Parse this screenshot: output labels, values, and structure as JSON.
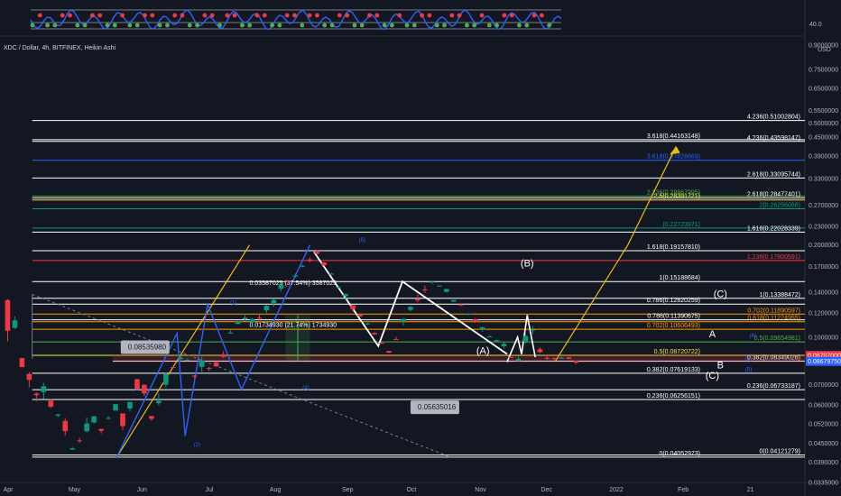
{
  "title": "XDC / Dollar, 4h, BITFINEX, Heikin Ashi",
  "indicator": {
    "level_label": "40.0"
  },
  "chart_data": {
    "type": "candlestick",
    "y_scale": "log",
    "ylim": [
      0.0335,
      0.95
    ],
    "y_ticks": [
      {
        "v": 0.9,
        "t": "0.9000000"
      },
      {
        "v": 0.75,
        "t": "0.7500000"
      },
      {
        "v": 0.65,
        "t": "0.6500000"
      },
      {
        "v": 0.55,
        "t": "0.5500000"
      },
      {
        "v": 0.5,
        "t": "0.5000000"
      },
      {
        "v": 0.45,
        "t": "0.4500000"
      },
      {
        "v": 0.39,
        "t": "0.3900000"
      },
      {
        "v": 0.33,
        "t": "0.3300000"
      },
      {
        "v": 0.27,
        "t": "0.2700000"
      },
      {
        "v": 0.23,
        "t": "0.2300000"
      },
      {
        "v": 0.2,
        "t": "0.2000000"
      },
      {
        "v": 0.17,
        "t": "0.1700000"
      },
      {
        "v": 0.14,
        "t": "0.1400000"
      },
      {
        "v": 0.12,
        "t": "0.1200000"
      },
      {
        "v": 0.1,
        "t": "0.1000000"
      },
      {
        "v": 0.07,
        "t": "0.0700000"
      },
      {
        "v": 0.06,
        "t": "0.0600000"
      },
      {
        "v": 0.052,
        "t": "0.0520000"
      },
      {
        "v": 0.045,
        "t": "0.0450000"
      },
      {
        "v": 0.039,
        "t": "0.0390000"
      },
      {
        "v": 0.0335,
        "t": "0.0335000"
      }
    ],
    "y_unit": "USD",
    "x_months": [
      "Apr",
      "May",
      "Jun",
      "Jul",
      "Aug",
      "Sep",
      "Oct",
      "Nov",
      "Dec",
      "2022",
      "Feb",
      "21"
    ],
    "price_tags": [
      {
        "v": 0.08707,
        "t": "0.08707000",
        "color": "#f23645"
      },
      {
        "v": 0.0868,
        "t": "0.08679750",
        "color": "#2962ff"
      }
    ],
    "levels": [
      {
        "v": 0.51003,
        "t": "4.236(0.51002804)",
        "color": "#ffffff",
        "start": 0.04
      },
      {
        "v": 0.44163,
        "t": "3.618(0.44163148)",
        "color": "#ffffff",
        "start": 0.04
      },
      {
        "v": 0.43598,
        "t": "4.236(0.43598147)",
        "color": "#ffffff",
        "start": 0.04
      },
      {
        "v": 0.3783,
        "t": "3.618(0.37828869)",
        "color": "#2962ff",
        "start": 0.04
      },
      {
        "v": 0.33096,
        "t": "2.618(0.33095744)",
        "color": "#ffffff",
        "start": 0.04
      },
      {
        "v": 0.2888,
        "t": "2.236(0.28867995)",
        "color": "#4caf50",
        "start": 0.04
      },
      {
        "v": 0.2848,
        "t": "2.618(0.28477401)",
        "color": "#ffffff",
        "start": 0.04
      },
      {
        "v": 0.2807,
        "t": "2.5(0.28391721)",
        "color": "#ffeb3b",
        "start": 0.04
      },
      {
        "v": 0.26256,
        "t": "2(0.26256088)",
        "color": "#089981",
        "start": 0.04
      },
      {
        "v": 0.22724,
        "t": "(0.22723971)",
        "color": "#089981",
        "start": 0.04
      },
      {
        "v": 0.22028,
        "t": "1.618(0.22028339)",
        "color": "#ffffff",
        "start": 0.04
      },
      {
        "v": 0.19158,
        "t": "1.618(0.19157810)",
        "color": "#ffffff",
        "start": 0.04
      },
      {
        "v": 0.178,
        "t": "1.236(0.17800591)",
        "color": "#f23645",
        "start": 0.04
      },
      {
        "v": 0.15189,
        "t": "1(0.15188684)",
        "color": "#ffffff",
        "start": 0.04
      },
      {
        "v": 0.13388,
        "t": "1(0.13388472)",
        "color": "#ffffff",
        "start": 0.04
      },
      {
        "v": 0.1282,
        "t": "0.786(0.12820259)",
        "color": "#ffffff",
        "start": 0.04
      },
      {
        "v": 0.1189,
        "t": "0.702(0.11890597)",
        "color": "#ff9800",
        "start": 0.04
      },
      {
        "v": 0.1139,
        "t": "0.786(0.11390675)",
        "color": "#ffffff",
        "start": 0.04
      },
      {
        "v": 0.1123,
        "t": "0.618(0.11224955)",
        "color": "#ff9800",
        "start": 0.04
      },
      {
        "v": 0.1061,
        "t": "0.702(0.10606493)",
        "color": "#ff9800",
        "start": 0.04
      },
      {
        "v": 0.0965,
        "t": "0.5(0.09654981)",
        "color": "#4caf50",
        "start": 0.04
      },
      {
        "v": 0.08721,
        "t": "0.5(0.08720722)",
        "color": "#ffeb3b",
        "start": 0.04
      },
      {
        "v": 0.08349,
        "t": "0.382(0.08349028)",
        "color": "#ffffff",
        "start": 0.14
      },
      {
        "v": 0.07619,
        "t": "0.382(0.07619133)",
        "color": "#ffffff",
        "start": 0.04
      },
      {
        "v": 0.06733,
        "t": "0.236(0.06733187)",
        "color": "#ffffff",
        "start": 0.04
      },
      {
        "v": 0.06256,
        "t": "0.236(0.06256151)",
        "color": "#ffffff",
        "start": 0.04
      },
      {
        "v": 0.04121,
        "t": "0(0.04121279)",
        "color": "#ffffff",
        "start": 0.04
      },
      {
        "v": 0.04053,
        "t": "0(0.04052973)",
        "color": "#ffffff",
        "start": 0.04
      }
    ],
    "annotations": {
      "box1": "0.08535980",
      "box2": "0.05635016",
      "measure1": "0.03587025 (37.54%) 3587025",
      "measure2": "0.01734930 (21.74%) 1734930"
    },
    "waves": [
      {
        "t": "(A)",
        "d": 0.6,
        "v": 0.088
      },
      {
        "t": "(B)",
        "d": 0.655,
        "v": 0.17
      },
      {
        "t": "(C)",
        "d": 0.895,
        "v": 0.135
      },
      {
        "t": "(C)",
        "d": 0.885,
        "v": 0.073
      },
      {
        "t": "A",
        "d": 0.885,
        "v": 0.1
      },
      {
        "t": "B",
        "d": 0.895,
        "v": 0.079
      },
      {
        "t": "(5)",
        "d": 0.45,
        "v": 0.205
      },
      {
        "t": "(4)",
        "d": 0.38,
        "v": 0.0675
      },
      {
        "t": "(2)",
        "d": 0.245,
        "v": 0.044
      },
      {
        "t": "(1)",
        "d": 0.29,
        "v": 0.128
      },
      {
        "t": "(5)",
        "d": 0.93,
        "v": 0.0775
      },
      {
        "t": "(3)",
        "d": 0.93,
        "v": 0.084
      },
      {
        "t": "(4)",
        "d": 0.935,
        "v": 0.1
      }
    ],
    "ohlc": [
      [
        0.1321,
        0.1331,
        0.0967,
        0.1049
      ],
      [
        0.1072,
        0.1169,
        0.1063,
        0.1134
      ],
      [
        0.0854,
        0.0854,
        0.0798,
        0.0798
      ],
      [
        0.0758,
        0.0768,
        0.0686,
        0.0725
      ],
      [
        0.0654,
        0.0659,
        0.0617,
        0.0646
      ],
      [
        0.0661,
        0.0709,
        0.0628,
        0.0691
      ],
      [
        0.062,
        0.0628,
        0.0586,
        0.0592
      ],
      [
        0.0554,
        0.0561,
        0.0547,
        0.0559
      ],
      [
        0.0532,
        0.0544,
        0.0476,
        0.0493
      ],
      [
        0.0429,
        0.0438,
        0.0428,
        0.0433
      ],
      [
        0.046,
        0.0469,
        0.0451,
        0.0459
      ],
      [
        0.0493,
        0.0546,
        0.0488,
        0.0522
      ],
      [
        0.0526,
        0.0553,
        0.0522,
        0.0551
      ],
      [
        0.0501,
        0.0503,
        0.0484,
        0.0494
      ],
      [
        0.0543,
        0.0552,
        0.0541,
        0.0544
      ],
      [
        0.0576,
        0.0606,
        0.0574,
        0.0604
      ],
      [
        0.0563,
        0.0564,
        0.0497,
        0.0512
      ],
      [
        0.0584,
        0.0615,
        0.0572,
        0.0614
      ],
      [
        0.0728,
        0.0732,
        0.0671,
        0.0678
      ],
      [
        0.0698,
        0.0703,
        0.0641,
        0.0654
      ],
      [
        0.0552,
        0.0553,
        0.0532,
        0.0541
      ],
      [
        0.0608,
        0.0655,
        0.0599,
        0.0619
      ],
      [
        0.0699,
        0.0765,
        0.0686,
        0.0757
      ],
      [
        0.0798,
        0.0805,
        0.0791,
        0.0793
      ],
      [
        0.0847,
        0.0872,
        0.0834,
        0.0859
      ],
      [
        0.0837,
        0.0853,
        0.0836,
        0.0843
      ],
      [
        0.0748,
        0.0752,
        0.0727,
        0.0743
      ],
      [
        0.0799,
        0.0862,
        0.0769,
        0.0837
      ],
      [
        0.0792,
        0.08,
        0.0774,
        0.0791
      ],
      [
        0.0827,
        0.0829,
        0.0801,
        0.0802
      ],
      [
        0.0879,
        0.09,
        0.0856,
        0.0862
      ],
      [
        0.1029,
        0.106,
        0.1026,
        0.1035
      ],
      [
        0.1105,
        0.1133,
        0.1104,
        0.1126
      ],
      [
        0.1144,
        0.118,
        0.1129,
        0.1157
      ],
      [
        0.1116,
        0.1154,
        0.1112,
        0.1147
      ],
      [
        0.1158,
        0.1182,
        0.1139,
        0.1155
      ],
      [
        0.1223,
        0.1274,
        0.1199,
        0.1266
      ],
      [
        0.1292,
        0.1334,
        0.1255,
        0.1322
      ],
      [
        0.1439,
        0.1516,
        0.1407,
        0.1483
      ],
      [
        0.1523,
        0.1528,
        0.1499,
        0.1519
      ],
      [
        0.1578,
        0.1613,
        0.1565,
        0.159
      ],
      [
        0.1705,
        0.1726,
        0.1692,
        0.171
      ],
      [
        0.1794,
        0.1823,
        0.1757,
        0.1771
      ],
      [
        0.19,
        0.1919,
        0.1863,
        0.1872
      ],
      [
        0.1752,
        0.1763,
        0.1704,
        0.1718
      ],
      [
        0.161,
        0.1621,
        0.1606,
        0.1612
      ],
      [
        0.1456,
        0.1464,
        0.1446,
        0.1457
      ],
      [
        0.1361,
        0.1388,
        0.1323,
        0.1383
      ],
      [
        0.127,
        0.127,
        0.1213,
        0.1233
      ],
      [
        0.1182,
        0.1186,
        0.1167,
        0.1169
      ],
      [
        0.1108,
        0.1116,
        0.1093,
        0.1108
      ],
      [
        0.1032,
        0.1037,
        0.1017,
        0.1021
      ],
      [
        0.0958,
        0.0967,
        0.0951,
        0.0955
      ],
      [
        0.0901,
        0.0901,
        0.0887,
        0.0889
      ],
      [
        0.0986,
        0.1003,
        0.0983,
        0.0985
      ],
      [
        0.1121,
        0.1154,
        0.1092,
        0.1146
      ],
      [
        0.1227,
        0.1264,
        0.1215,
        0.1255
      ],
      [
        0.1331,
        0.1379,
        0.1299,
        0.1318
      ],
      [
        0.1431,
        0.1473,
        0.1396,
        0.1426
      ],
      [
        0.1517,
        0.152,
        0.1494,
        0.1518
      ],
      [
        0.1473,
        0.1475,
        0.1466,
        0.1473
      ],
      [
        0.1406,
        0.1441,
        0.1398,
        0.1436
      ],
      [
        0.1306,
        0.1326,
        0.1304,
        0.1322
      ],
      [
        0.1279,
        0.1284,
        0.1262,
        0.1273
      ],
      [
        0.119,
        0.1196,
        0.1177,
        0.1194
      ],
      [
        0.1144,
        0.1153,
        0.1114,
        0.1118
      ],
      [
        0.1059,
        0.1081,
        0.1042,
        0.1077
      ],
      [
        0.1005,
        0.1015,
        0.0997,
        0.1005
      ],
      [
        0.0969,
        0.098,
        0.0967,
        0.0978
      ],
      [
        0.0933,
        0.0963,
        0.0917,
        0.0951
      ],
      [
        0.0861,
        0.0861,
        0.0856,
        0.0859
      ],
      [
        0.0836,
        0.0865,
        0.0835,
        0.0849
      ],
      [
        0.0966,
        0.1032,
        0.0956,
        0.1009
      ],
      [
        0.1053,
        0.1087,
        0.1021,
        0.1058
      ],
      [
        0.0913,
        0.0926,
        0.0887,
        0.0893
      ],
      [
        0.0855,
        0.0877,
        0.0845,
        0.0852
      ],
      [
        0.0853,
        0.0857,
        0.0842,
        0.0849
      ],
      [
        0.0851,
        0.0861,
        0.0849,
        0.0858
      ],
      [
        0.0859,
        0.0861,
        0.0847,
        0.085
      ],
      [
        0.0838,
        0.0839,
        0.0816,
        0.0825
      ]
    ]
  }
}
